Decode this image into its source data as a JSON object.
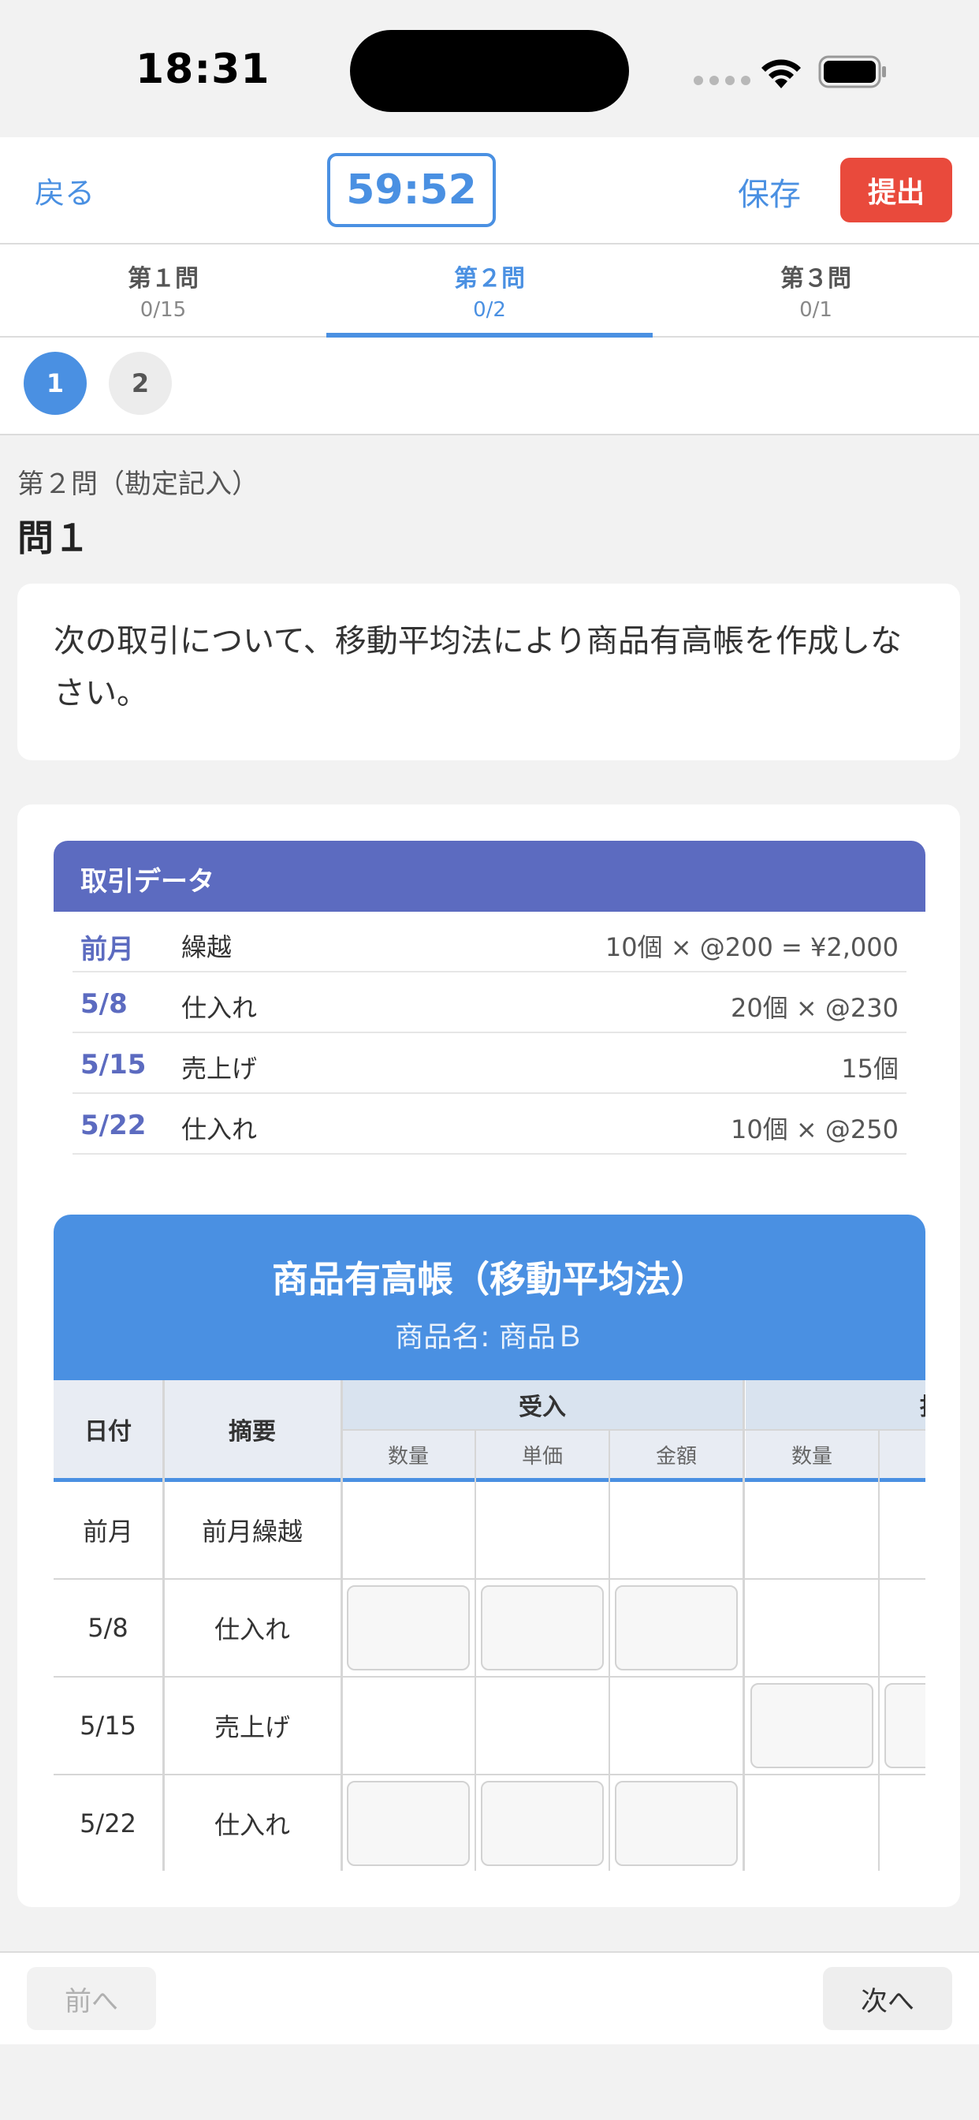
{
  "status_bar": {
    "time": "18:31"
  },
  "header": {
    "back_label": "戻る",
    "timer": "59:52",
    "save_label": "保存",
    "submit_label": "提出"
  },
  "tabs": [
    {
      "title": "第１問",
      "progress": "0/15",
      "active": false
    },
    {
      "title": "第２問",
      "progress": "0/2",
      "active": true
    },
    {
      "title": "第３問",
      "progress": "0/1",
      "active": false
    }
  ],
  "pager": {
    "items": [
      "1",
      "2"
    ],
    "current": "1"
  },
  "question": {
    "section": "第２問（勘定記入）",
    "title": "問１",
    "prompt": "次の取引について、移動平均法により商品有高帳を作成しなさい。"
  },
  "transactions": {
    "title": "取引データ",
    "rows": [
      {
        "date": "前月",
        "desc": "繰越",
        "amount": "10個 × @200 = ¥2,000"
      },
      {
        "date": "5/8",
        "desc": "仕入れ",
        "amount": "20個 × @230"
      },
      {
        "date": "5/15",
        "desc": "売上げ",
        "amount": "15個"
      },
      {
        "date": "5/22",
        "desc": "仕入れ",
        "amount": "10個 × @250"
      }
    ]
  },
  "ledger": {
    "title": "商品有高帳（移動平均法）",
    "product": "商品名: 商品Ｂ",
    "col_date": "日付",
    "col_desc": "摘要",
    "group_received": "受入",
    "group_issued": "払",
    "sub_qty": "数量",
    "sub_price": "単価",
    "sub_amount": "金額",
    "rows": [
      {
        "date": "前月",
        "desc": "前月繰越"
      },
      {
        "date": "5/8",
        "desc": "仕入れ"
      },
      {
        "date": "5/15",
        "desc": "売上げ"
      },
      {
        "date": "5/22",
        "desc": "仕入れ"
      }
    ]
  },
  "bottom_nav": {
    "prev_label": "前へ",
    "next_label": "次へ"
  },
  "colors": {
    "accent": "#4a90e2",
    "submit": "#e94a3c",
    "data_header": "#5c6bc0"
  }
}
